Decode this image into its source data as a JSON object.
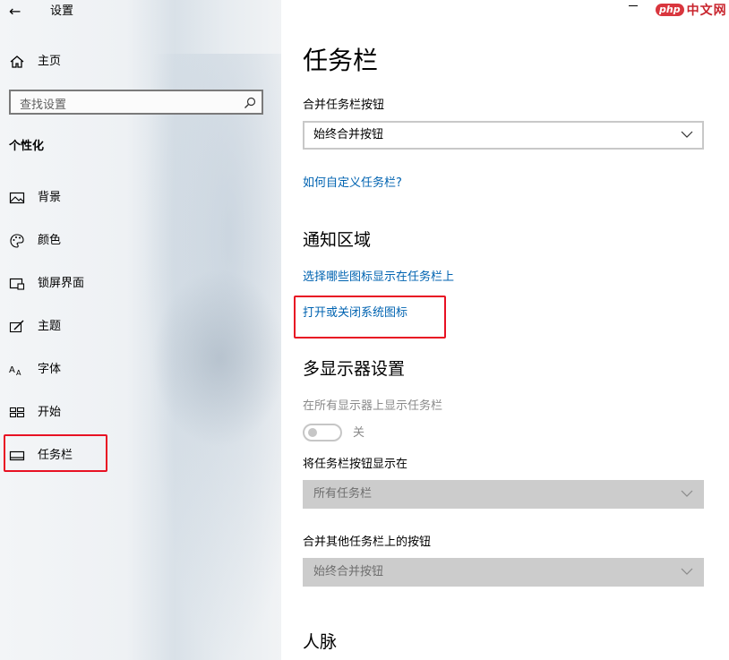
{
  "window": {
    "title": "设置",
    "brand_badge": "php",
    "brand_text": "中文网"
  },
  "sidebar": {
    "home_label": "主页",
    "search_placeholder": "查找设置",
    "section_title": "个性化",
    "items": [
      {
        "label": "背景",
        "icon": "picture-icon"
      },
      {
        "label": "颜色",
        "icon": "palette-icon"
      },
      {
        "label": "锁屏界面",
        "icon": "lock-screen-icon"
      },
      {
        "label": "主题",
        "icon": "theme-brush-icon"
      },
      {
        "label": "字体",
        "icon": "font-icon"
      },
      {
        "label": "开始",
        "icon": "start-grid-icon"
      },
      {
        "label": "任务栏",
        "icon": "taskbar-icon",
        "selected": true
      }
    ]
  },
  "main": {
    "title": "任务栏",
    "combine_buttons_label": "合并任务栏按钮",
    "combine_buttons_value": "始终合并按钮",
    "customize_link": "如何自定义任务栏?",
    "notification_area": {
      "heading": "通知区域",
      "link_select_icons": "选择哪些图标显示在任务栏上",
      "link_system_icons": "打开或关闭系统图标"
    },
    "multi_display": {
      "heading": "多显示器设置",
      "show_taskbar_label": "在所有显示器上显示任务栏",
      "toggle_state": "关",
      "show_buttons_label": "将任务栏按钮显示在",
      "show_buttons_value": "所有任务栏",
      "combine_other_label": "合并其他任务栏上的按钮",
      "combine_other_value": "始终合并按钮"
    },
    "people_heading": "人脉"
  },
  "colors": {
    "link": "#0063b1",
    "highlight": "#e81123",
    "disabled_text": "#8a8a8a"
  }
}
